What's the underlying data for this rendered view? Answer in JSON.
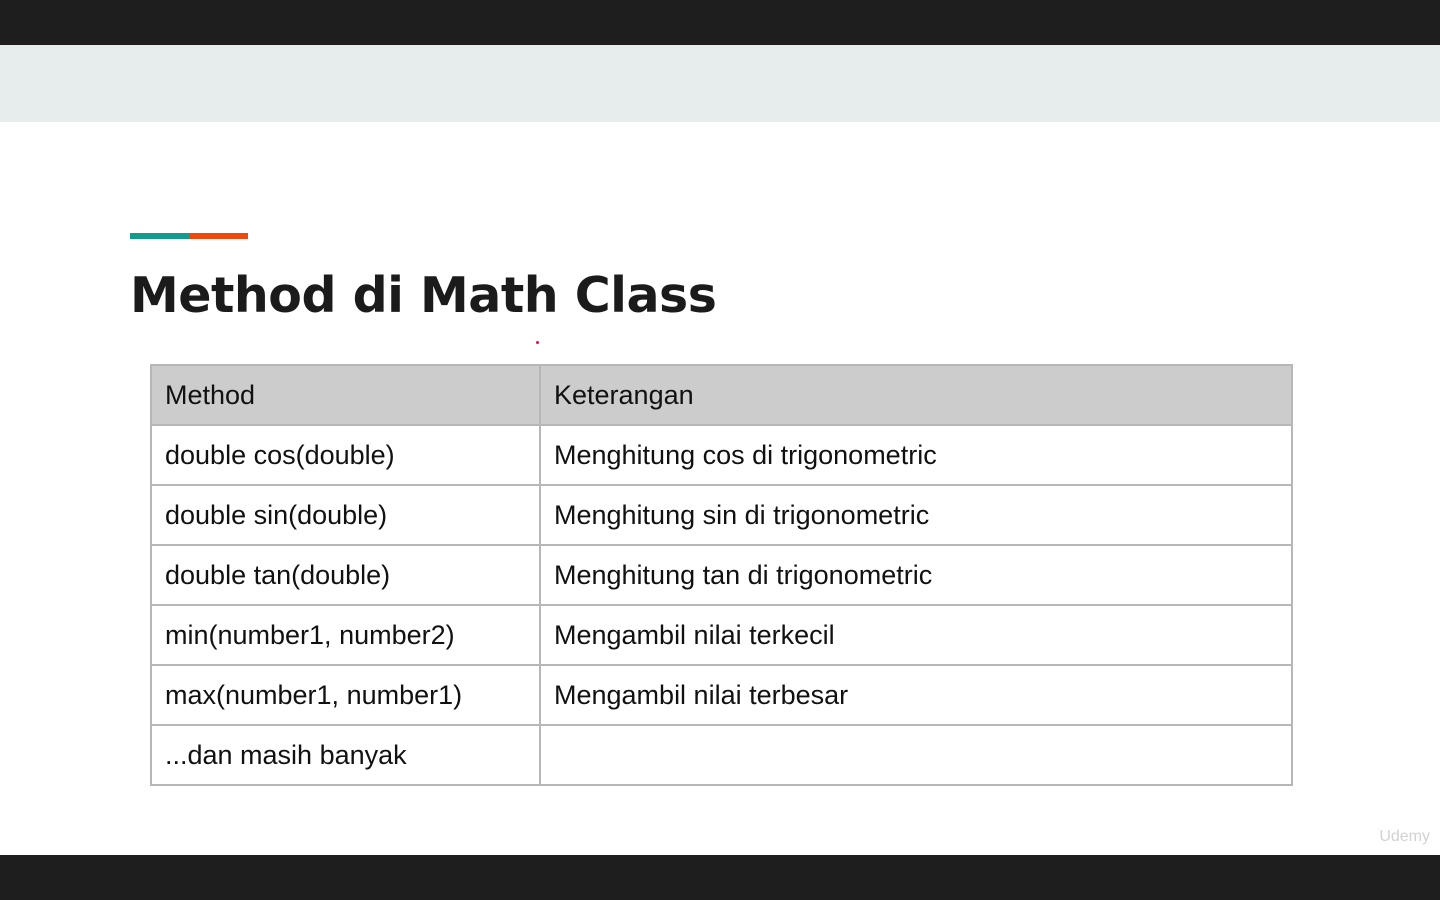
{
  "slide": {
    "title": "Method di Math Class",
    "accent_colors": [
      "#139b8e",
      "#f0470f"
    ],
    "header_band_color": "#e7ecec"
  },
  "table": {
    "headers": [
      "Method",
      "Keterangan"
    ],
    "rows": [
      [
        "double cos(double)",
        "Menghitung cos di trigonometric"
      ],
      [
        "double sin(double)",
        "Menghitung sin di trigonometric"
      ],
      [
        "double tan(double)",
        "Menghitung tan di trigonometric"
      ],
      [
        "min(number1, number2)",
        "Mengambil nilai terkecil"
      ],
      [
        "max(number1, number1)",
        "Mengambil nilai terbesar"
      ],
      [
        "...dan masih banyak",
        ""
      ]
    ]
  },
  "watermark": "Udemy"
}
